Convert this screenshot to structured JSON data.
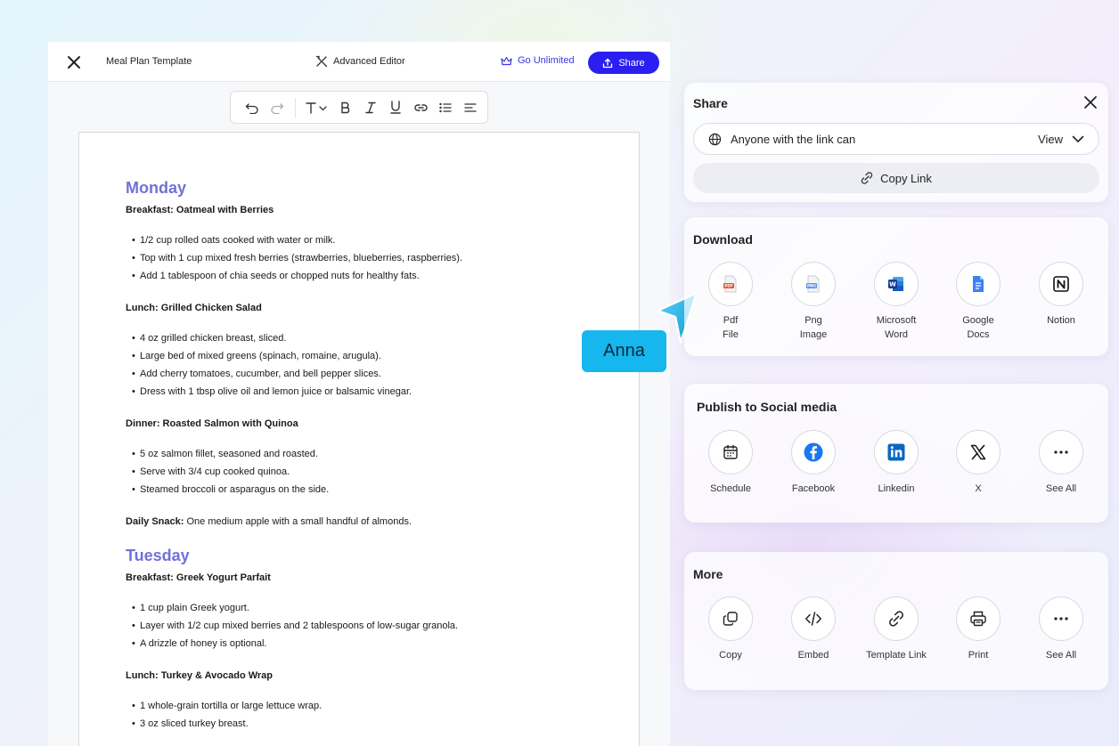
{
  "editor": {
    "title": "Meal Plan Template",
    "advanced_editor_label": "Advanced Editor",
    "go_unlimited_label": "Go Unlimited",
    "share_label": "Share",
    "accent_color": "#2b1ef0"
  },
  "document": {
    "days": [
      {
        "day": "Monday",
        "meals": [
          {
            "heading": "Breakfast: Oatmeal with Berries",
            "items": [
              "1/2 cup rolled oats cooked with water or milk.",
              "Top with 1 cup mixed fresh berries (strawberries, blueberries, raspberries).",
              "Add 1 tablespoon of chia seeds or chopped nuts for healthy fats."
            ]
          },
          {
            "heading": "Lunch: Grilled Chicken Salad",
            "items": [
              "4 oz grilled chicken breast, sliced.",
              "Large bed of mixed greens (spinach, romaine, arugula).",
              "Add cherry tomatoes, cucumber, and bell pepper slices.",
              "Dress with 1 tbsp olive oil and lemon juice or balsamic vinegar."
            ]
          },
          {
            "heading": "Dinner: Roasted Salmon with Quinoa",
            "items": [
              "5 oz salmon fillet, seasoned and roasted.",
              "Serve with 3/4 cup cooked quinoa.",
              "Steamed broccoli or asparagus on the side."
            ]
          }
        ],
        "snack_label": "Daily Snack:",
        "snack_text": " One medium apple with a small handful of almonds."
      },
      {
        "day": "Tuesday",
        "meals": [
          {
            "heading": "Breakfast: Greek Yogurt Parfait",
            "items": [
              "1 cup plain Greek yogurt.",
              "Layer with 1/2 cup mixed berries and 2 tablespoons of low-sugar granola.",
              "A drizzle of honey is optional."
            ]
          },
          {
            "heading": "Lunch: Turkey & Avocado Wrap",
            "items": [
              "1 whole-grain tortilla or large lettuce wrap.",
              "3 oz sliced turkey breast."
            ]
          }
        ]
      }
    ]
  },
  "collaborator": {
    "name": "Anna",
    "color": "#16b6ee"
  },
  "share_panel": {
    "title": "Share",
    "access_label": "Anyone with the link can",
    "permission": "View",
    "copy_link_label": "Copy Link"
  },
  "download": {
    "title": "Download",
    "items": [
      {
        "icon": "pdf-file-icon",
        "label": "Pdf\nFile"
      },
      {
        "icon": "png-image-icon",
        "label": "Png\nImage"
      },
      {
        "icon": "microsoft-word-icon",
        "label": "Microsoft\nWord"
      },
      {
        "icon": "google-docs-icon",
        "label": "Google\nDocs"
      },
      {
        "icon": "notion-icon",
        "label": "Notion"
      }
    ]
  },
  "social": {
    "title": "Publish to Social media",
    "items": [
      {
        "icon": "calendar-icon",
        "label": "Schedule"
      },
      {
        "icon": "facebook-icon",
        "label": "Facebook"
      },
      {
        "icon": "linkedin-icon",
        "label": "Linkedin"
      },
      {
        "icon": "x-icon",
        "label": "X"
      },
      {
        "icon": "more-icon",
        "label": "See All"
      }
    ]
  },
  "more": {
    "title": "More",
    "items": [
      {
        "icon": "copy-icon",
        "label": "Copy"
      },
      {
        "icon": "embed-icon",
        "label": "Embed"
      },
      {
        "icon": "link-icon",
        "label": "Template Link"
      },
      {
        "icon": "print-icon",
        "label": "Print"
      },
      {
        "icon": "more-icon",
        "label": "See All"
      }
    ]
  }
}
